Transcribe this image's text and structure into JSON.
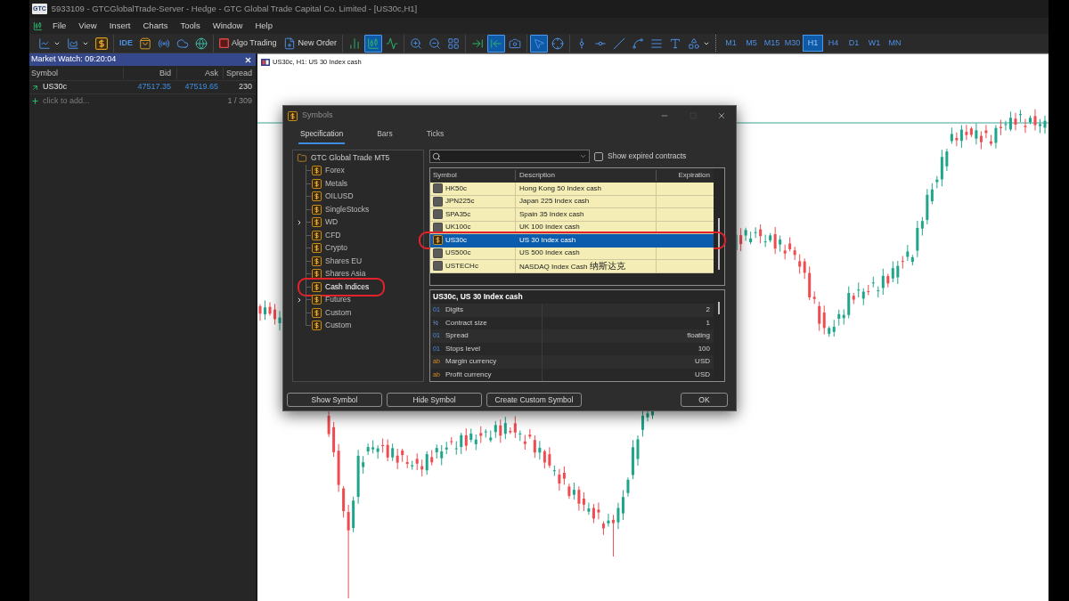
{
  "window": {
    "logo": "GTC",
    "title": "5933109 - GTCGlobalTrade-Server - Hedge - GTC Global Trade Capital Co. Limited - [US30c,H1]"
  },
  "menu": [
    "File",
    "View",
    "Insert",
    "Charts",
    "Tools",
    "Window",
    "Help"
  ],
  "toolbar": [
    [
      {
        "kind": "linechart",
        "selected": false
      },
      {
        "kind": "templates",
        "selected": false
      },
      {
        "kind": "dollar",
        "selected": false
      }
    ],
    [
      {
        "kind": "ide",
        "label": "IDE",
        "selected": false
      },
      {
        "kind": "market",
        "selected": false
      },
      {
        "kind": "signals",
        "selected": false
      },
      {
        "kind": "vps",
        "selected": false
      },
      {
        "kind": "globe",
        "selected": false
      }
    ],
    [
      {
        "kind": "algo",
        "label": "Algo Trading",
        "on": false,
        "selected": false
      },
      {
        "kind": "order",
        "label": "New Order",
        "selected": false
      }
    ],
    [
      {
        "kind": "bars",
        "selected": false
      },
      {
        "kind": "candles",
        "selected": true
      },
      {
        "kind": "line",
        "selected": false
      }
    ],
    [
      {
        "kind": "zoomin",
        "selected": false
      },
      {
        "kind": "zoomout",
        "selected": false
      },
      {
        "kind": "tile",
        "selected": false
      }
    ],
    [
      {
        "kind": "shift",
        "selected": false
      },
      {
        "kind": "autoscroll",
        "selected": true
      },
      {
        "kind": "screenshot",
        "selected": false
      }
    ],
    [
      {
        "kind": "cursor",
        "selected": true
      },
      {
        "kind": "crosshair",
        "selected": false
      }
    ],
    [
      {
        "kind": "vline",
        "selected": false
      },
      {
        "kind": "hline",
        "selected": false
      },
      {
        "kind": "trend",
        "selected": false
      },
      {
        "kind": "channel",
        "selected": false
      },
      {
        "kind": "fibo",
        "selected": false
      },
      {
        "kind": "text",
        "selected": false
      },
      {
        "kind": "shapes",
        "selected": false
      }
    ]
  ],
  "timeframes": [
    {
      "label": "M1",
      "selected": false
    },
    {
      "label": "M5",
      "selected": false
    },
    {
      "label": "M15",
      "selected": false
    },
    {
      "label": "M30",
      "selected": false
    },
    {
      "label": "H1",
      "selected": true
    },
    {
      "label": "H4",
      "selected": false
    },
    {
      "label": "D1",
      "selected": false
    },
    {
      "label": "W1",
      "selected": false
    },
    {
      "label": "MN",
      "selected": false
    }
  ],
  "market_watch": {
    "title": "Market Watch: 09:20:04",
    "columns": [
      "Symbol",
      "Bid",
      "Ask",
      "Spread"
    ],
    "rows": [
      {
        "symbol": "US30c",
        "bid": "47517.35",
        "ask": "47519.65",
        "spread": "230",
        "rising": true
      }
    ],
    "add_hint": "click to add...",
    "count": "1 / 309"
  },
  "chart": {
    "title": "US30c, H1: US 30 Index cash"
  },
  "symbols_dialog": {
    "title": "Symbols",
    "tabs": [
      {
        "label": "Specification",
        "selected": true
      },
      {
        "label": "Bars",
        "selected": false
      },
      {
        "label": "Ticks",
        "selected": false
      }
    ],
    "tree": {
      "label": "GTC Global Trade MT5",
      "children": [
        {
          "label": "Forex",
          "collapsed": false,
          "selected": false,
          "circled": false
        },
        {
          "label": "Metals",
          "collapsed": false,
          "selected": false,
          "circled": false
        },
        {
          "label": "OILUSD",
          "collapsed": false,
          "selected": false,
          "circled": false
        },
        {
          "label": "SingleStocks",
          "collapsed": false,
          "selected": false,
          "circled": false
        },
        {
          "label": "WD",
          "collapsed": true,
          "selected": false,
          "circled": false
        },
        {
          "label": "CFD",
          "collapsed": false,
          "selected": false,
          "circled": false
        },
        {
          "label": "Crypto",
          "collapsed": false,
          "selected": false,
          "circled": false
        },
        {
          "label": "Shares EU",
          "collapsed": false,
          "selected": false,
          "circled": false
        },
        {
          "label": "Shares Asia",
          "collapsed": false,
          "selected": false,
          "circled": false
        },
        {
          "label": "Cash Indices",
          "collapsed": false,
          "selected": true,
          "circled": true
        },
        {
          "label": "Futures",
          "collapsed": true,
          "selected": false,
          "circled": false
        },
        {
          "label": "Custom",
          "collapsed": false,
          "selected": false,
          "circled": false
        },
        {
          "label": "Custom",
          "collapsed": false,
          "selected": false,
          "circled": false
        }
      ]
    },
    "show_expired": {
      "label": "Show expired contracts",
      "checked": false
    },
    "table": {
      "columns": [
        "Symbol",
        "Description",
        "Expiration"
      ],
      "rows": [
        {
          "symbol": "HK50c",
          "description": "Hong Kong 50 Index cash",
          "active": false,
          "selected": false,
          "circled": false
        },
        {
          "symbol": "JPN225c",
          "description": "Japan 225 Index cash",
          "active": false,
          "selected": false,
          "circled": false
        },
        {
          "symbol": "SPA35c",
          "description": "Spain 35 Index cash",
          "active": false,
          "selected": false,
          "circled": false
        },
        {
          "symbol": "UK100c",
          "description": "UK 100 Index cash",
          "active": false,
          "selected": false,
          "circled": false
        },
        {
          "symbol": "US30c",
          "description": "US 30 Index cash",
          "active": true,
          "selected": true,
          "circled": true
        },
        {
          "symbol": "US500c",
          "description": "US 500 Index cash",
          "active": false,
          "selected": false,
          "circled": false
        },
        {
          "symbol": "USTECHc",
          "description": "NASDAQ Index Cash 纳斯达克",
          "active": false,
          "selected": false,
          "circled": false
        }
      ]
    },
    "details": {
      "title": "US30c, US 30 Index cash",
      "rows": [
        {
          "icon": "01",
          "kind": "number",
          "name": "Digits",
          "value": "2"
        },
        {
          "icon": "½",
          "kind": "fraction",
          "name": "Contract size",
          "value": "1"
        },
        {
          "icon": "01",
          "kind": "number",
          "name": "Spread",
          "value": "floating"
        },
        {
          "icon": "01",
          "kind": "number",
          "name": "Stops level",
          "value": "100"
        },
        {
          "icon": "ab",
          "kind": "text",
          "name": "Margin currency",
          "value": "USD"
        },
        {
          "icon": "ab",
          "kind": "text",
          "name": "Profit currency",
          "value": "USD"
        }
      ]
    },
    "buttons": [
      "Show Symbol",
      "Hide Symbol",
      "Create Custom Symbol"
    ],
    "ok": "OK"
  }
}
